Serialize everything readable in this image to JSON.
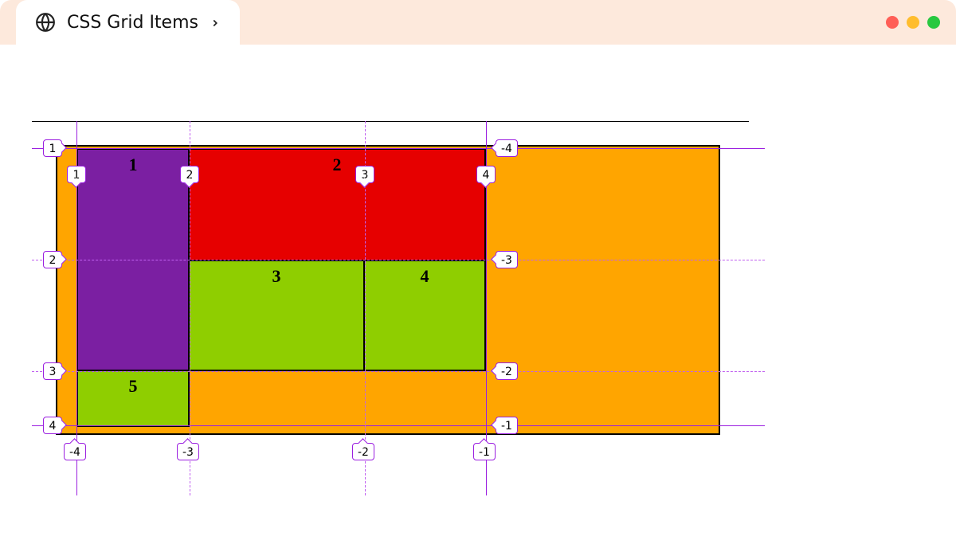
{
  "tab": {
    "title": "CSS Grid Items"
  },
  "cells": [
    {
      "label": "1",
      "color": "purple",
      "colStart": 1,
      "colEnd": 2,
      "rowStart": 1,
      "rowEnd": 3
    },
    {
      "label": "2",
      "color": "red",
      "colStart": 2,
      "colEnd": 4,
      "rowStart": 1,
      "rowEnd": 2
    },
    {
      "label": "3",
      "color": "yellowgreen",
      "colStart": 2,
      "colEnd": 3,
      "rowStart": 2,
      "rowEnd": 3
    },
    {
      "label": "4",
      "color": "yellowgreen",
      "colStart": 3,
      "colEnd": 4,
      "rowStart": 2,
      "rowEnd": 3
    },
    {
      "label": "5",
      "color": "yellowgreen",
      "colStart": 1,
      "colEnd": 2,
      "rowStart": 3,
      "rowEnd": 4
    }
  ],
  "colsPos": [
    "1",
    "2",
    "3",
    "4"
  ],
  "colsNeg": [
    "-4",
    "-3",
    "-2",
    "-1"
  ],
  "rowsPos": [
    "1",
    "2",
    "3",
    "4"
  ],
  "rowsNeg": [
    "-4",
    "-3",
    "-2",
    "-1"
  ],
  "colors": {
    "container": "#ff9800",
    "purple": "#7b1fa2",
    "red": "#e60000",
    "green": "#8fce00",
    "gridline": "#9b1fe0"
  },
  "chart_data": {
    "type": "table",
    "description": "CSS Grid layout with 3 columns × 3 rows track area; labels show positive and negative grid line numbers.",
    "columnLines": [
      1,
      2,
      3,
      4
    ],
    "rowLines": [
      1,
      2,
      3,
      4
    ],
    "negativeColumnLines": [
      -4,
      -3,
      -2,
      -1
    ],
    "negativeRowLines": [
      -4,
      -3,
      -2,
      -1
    ],
    "items": [
      {
        "id": 1,
        "bg": "purple",
        "col": "1 / 2",
        "row": "1 / 3"
      },
      {
        "id": 2,
        "bg": "red",
        "col": "2 / 4",
        "row": "1 / 2"
      },
      {
        "id": 3,
        "bg": "yellowgreen",
        "col": "2 / 3",
        "row": "2 / 3"
      },
      {
        "id": 4,
        "bg": "yellowgreen",
        "col": "3 / 4",
        "row": "2 / 3"
      },
      {
        "id": 5,
        "bg": "yellowgreen",
        "col": "1 / 2",
        "row": "3 / 4"
      }
    ]
  }
}
